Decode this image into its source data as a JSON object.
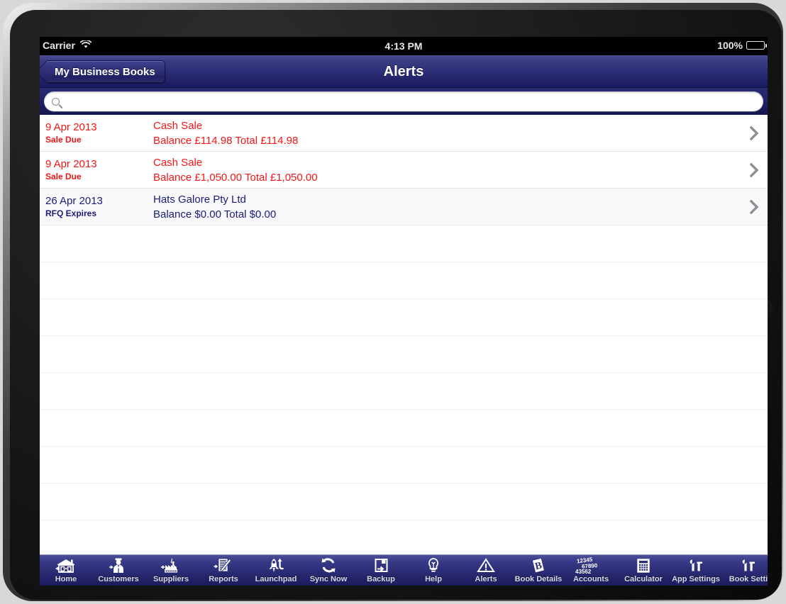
{
  "device": {
    "name": "ipad-landscape"
  },
  "status_bar": {
    "carrier": "Carrier",
    "wifi_icon": "wifi-icon",
    "time": "4:13 PM",
    "battery_percent": "100%",
    "battery_icon": "battery-full-icon"
  },
  "nav_bar": {
    "back_label": "My Business Books",
    "title": "Alerts"
  },
  "search": {
    "value": "",
    "placeholder": "",
    "icon": "search-icon"
  },
  "list": {
    "rows": [
      {
        "date": "9 Apr 2013",
        "kind": "Sale Due",
        "title": "Cash Sale",
        "subtitle": "Balance £114.98 Total £114.98",
        "color": "#f51616",
        "chevron": "chevron-right-icon"
      },
      {
        "date": "9 Apr 2013",
        "kind": "Sale Due",
        "title": "Cash Sale",
        "subtitle": "Balance £1,050.00 Total £1,050.00",
        "color": "#f51616",
        "chevron": "chevron-right-icon"
      },
      {
        "date": "26 Apr 2013",
        "kind": "RFQ Expires",
        "title": "Hats Galore Pty Ltd",
        "subtitle": "Balance $0.00 Total $0.00",
        "color": "#1b1b7a",
        "chevron": "chevron-right-icon"
      }
    ],
    "empty_row_count": 9
  },
  "toolbar": {
    "items": [
      {
        "label": "Home",
        "icon": "house-icon"
      },
      {
        "label": "Customers",
        "icon": "person-customer-icon"
      },
      {
        "label": "Suppliers",
        "icon": "factory-icon"
      },
      {
        "label": "Reports",
        "icon": "report-pencil-icon"
      },
      {
        "label": "Launchpad",
        "icon": "rocket-icon"
      },
      {
        "label": "Sync Now",
        "icon": "sync-refresh-icon"
      },
      {
        "label": "Backup",
        "icon": "floppy-disk-icon"
      },
      {
        "label": "Help",
        "icon": "lightbulb-icon"
      },
      {
        "label": "Alerts",
        "icon": "warning-triangle-icon"
      },
      {
        "label": "Book Details",
        "icon": "book-b-icon"
      },
      {
        "label": "Accounts",
        "icon": "numbers-icon",
        "numbers": [
          "12345",
          "67890",
          "43562"
        ]
      },
      {
        "label": "Calculator",
        "icon": "calculator-icon"
      },
      {
        "label": "App Settings",
        "icon": "tools-icon"
      },
      {
        "label": "Book Setti",
        "icon": "tools-icon"
      }
    ]
  },
  "colors": {
    "nav_top": "#4a4d94",
    "nav_bottom": "#191a60",
    "alert_red": "#f51616",
    "alert_navy": "#1b1b7a",
    "toolbar_text": "#d6d6e6"
  }
}
